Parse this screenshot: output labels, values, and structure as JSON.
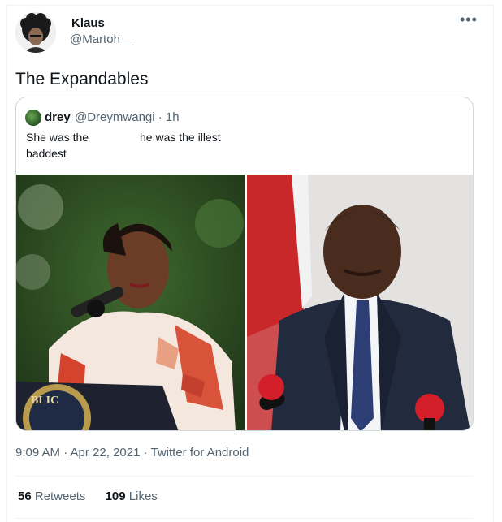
{
  "author": {
    "display_name": "Klaus",
    "handle": "@Martoh__"
  },
  "menu_icon": "more-horizontal-icon",
  "tweet": {
    "text": "The Expandables"
  },
  "quoted_tweet": {
    "display_name": "drey",
    "handle_meta": "@Dreymwangi · 1h",
    "text_line_1": "She was the",
    "text_line_2": "baddest",
    "text_line_3": "he was the illest"
  },
  "meta": {
    "time": "9:09 AM · Apr 22, 2021 · ",
    "source": "Twitter for Android"
  },
  "stats": {
    "retweets_count": "56",
    "retweets_label": "Retweets",
    "likes_count": "109",
    "likes_label": "Likes"
  }
}
